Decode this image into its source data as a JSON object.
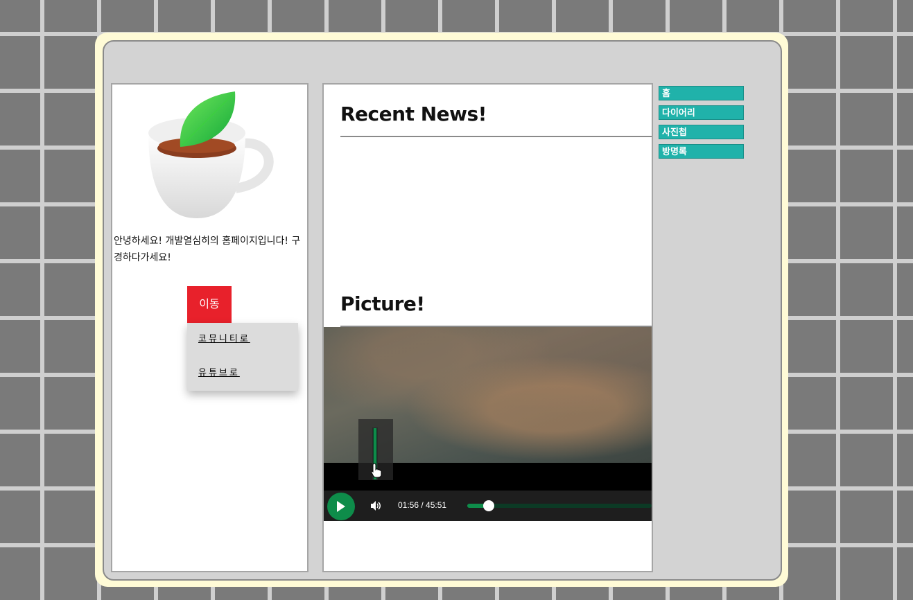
{
  "intro": {
    "text": "안녕하세요! 개발열심히의 홈페이지입니다! 구경하다가세요!"
  },
  "move": {
    "button_label": "이동",
    "items": [
      "코뮤니티로",
      "유튜브로"
    ]
  },
  "main": {
    "recent_heading": "Recent News!",
    "picture_heading": "Picture!"
  },
  "player": {
    "time": "01:56 / 45:51",
    "progress": 0.042,
    "volume": 1.0,
    "colors": {
      "accent": "#0e8c4a",
      "track": "#0c3a25"
    }
  },
  "nav": {
    "items": [
      "홈",
      "다이어리",
      "사진첩",
      "방명록"
    ],
    "color": "#20b2aa"
  },
  "theme": {
    "move_button_color": "#e8212b"
  }
}
